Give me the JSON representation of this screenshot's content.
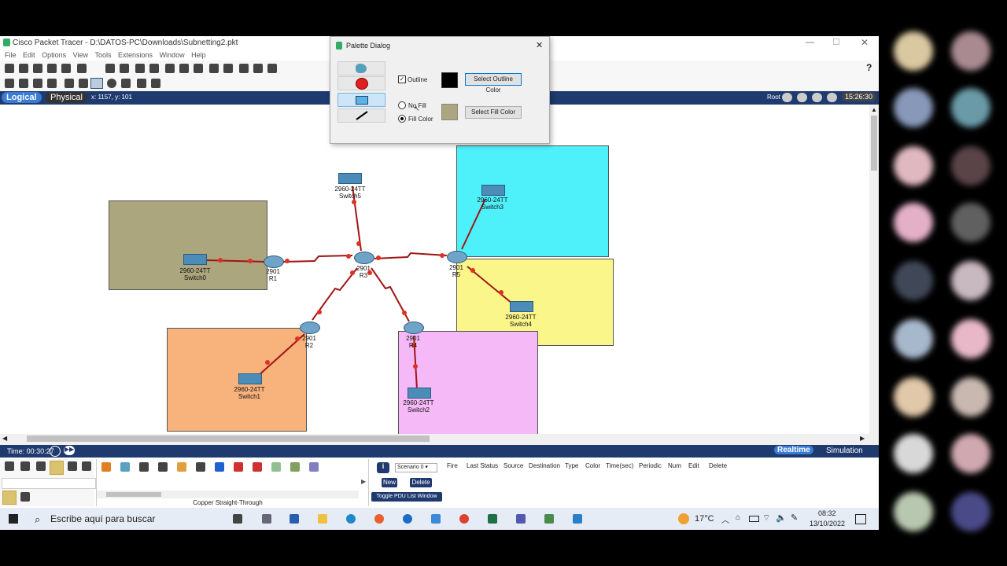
{
  "window": {
    "title": "Cisco Packet Tracer - D:\\DATOS-PC\\Downloads\\Subnetting2.pkt"
  },
  "menu": [
    "File",
    "Edit",
    "Options",
    "View",
    "Tools",
    "Extensions",
    "Window",
    "Help"
  ],
  "nav": {
    "logical": "Logical",
    "physical": "Physical",
    "coords": "x: 1157, y: 101",
    "root": "Root",
    "clock": "15:26:30"
  },
  "dialog": {
    "title": "Palette Dialog",
    "outline_label": "Outline",
    "select_outline": "Select Outline Color",
    "no_fill": "No Fill",
    "fill_color": "Fill Color",
    "select_fill": "Select Fill Color"
  },
  "devices": {
    "switch5": {
      "model": "2960-24TT",
      "name": "Switch5"
    },
    "switch3": {
      "model": "2960-24TT",
      "name": "Switch3"
    },
    "switch0": {
      "model": "2960-24TT",
      "name": "Switch0"
    },
    "switch4": {
      "model": "2960-24TT",
      "name": "Switch4"
    },
    "switch1": {
      "model": "2960-24TT",
      "name": "Switch1"
    },
    "switch2": {
      "model": "2960-24TT",
      "name": "Switch2"
    },
    "r1": {
      "model": "2901",
      "name": "R1"
    },
    "r3": {
      "model": "2901",
      "name": "R3"
    },
    "r5": {
      "model": "2901",
      "name": "R5"
    },
    "r2": {
      "model": "2901",
      "name": "R2"
    },
    "r4": {
      "model": "2901",
      "name": "R4"
    }
  },
  "status": {
    "time": "Time: 00:30:27",
    "realtime": "Realtime",
    "simulation": "Simulation"
  },
  "bottom": {
    "cable_label": "Copper Straight-Through",
    "scenario": "Scenario 0",
    "new": "New",
    "delete": "Delete",
    "toggle_pdu": "Toggle PDU List Window",
    "pdu_headers": [
      "Fire",
      "Last Status",
      "Source",
      "Destination",
      "Type",
      "Color",
      "Time(sec)",
      "Periodic",
      "Num",
      "Edit",
      "Delete"
    ]
  },
  "taskbar": {
    "search": "Escribe aquí para buscar",
    "temp": "17°C",
    "time": "08:32",
    "date": "13/10/2022"
  },
  "colors": {
    "cyan": "#4ef0fa",
    "yellow": "#fbf68a",
    "olive": "#aca67e",
    "orange": "#f8b27c",
    "pink": "#f4b9f6",
    "fill_swatch": "#aca67e",
    "outline_swatch": "#000000"
  }
}
